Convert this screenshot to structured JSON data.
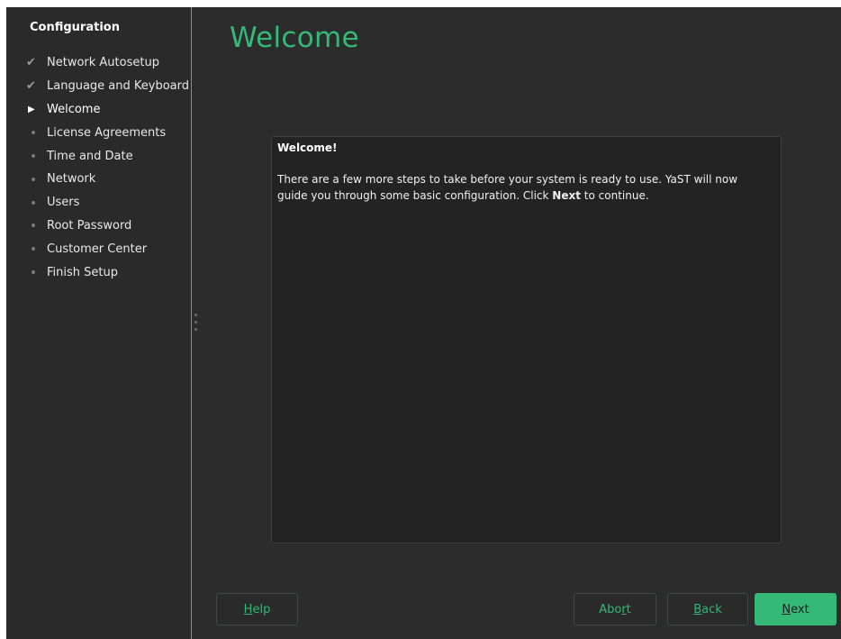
{
  "sidebar": {
    "title": "Configuration",
    "steps": [
      {
        "label": "Network Autosetup",
        "state": "done"
      },
      {
        "label": "Language and Keyboard",
        "state": "done"
      },
      {
        "label": "Welcome",
        "state": "current"
      },
      {
        "label": "License Agreements",
        "state": "pending"
      },
      {
        "label": "Time and Date",
        "state": "pending"
      },
      {
        "label": "Network",
        "state": "pending"
      },
      {
        "label": "Users",
        "state": "pending"
      },
      {
        "label": "Root Password",
        "state": "pending"
      },
      {
        "label": "Customer Center",
        "state": "pending"
      },
      {
        "label": "Finish Setup",
        "state": "pending"
      }
    ]
  },
  "main": {
    "title": "Welcome",
    "panel": {
      "heading": "Welcome!",
      "body_before": "There are a few more steps to take before your system is ready to use. YaST will now guide you through some basic configuration. Click ",
      "body_bold": "Next",
      "body_after": " to continue."
    }
  },
  "buttons": {
    "help": {
      "mnemonic": "H",
      "rest": "elp"
    },
    "abort": {
      "before": "Abo",
      "mnemonic": "r",
      "after": "t"
    },
    "back": {
      "mnemonic": "B",
      "rest": "ack"
    },
    "next": {
      "mnemonic": "N",
      "rest": "ext"
    }
  },
  "colors": {
    "accent": "#35b977",
    "background": "#2c2c2c",
    "panel": "#232323"
  },
  "icons": {
    "done": "checkmark-icon",
    "current": "play-arrow-icon",
    "pending": "bullet-dot-icon"
  }
}
